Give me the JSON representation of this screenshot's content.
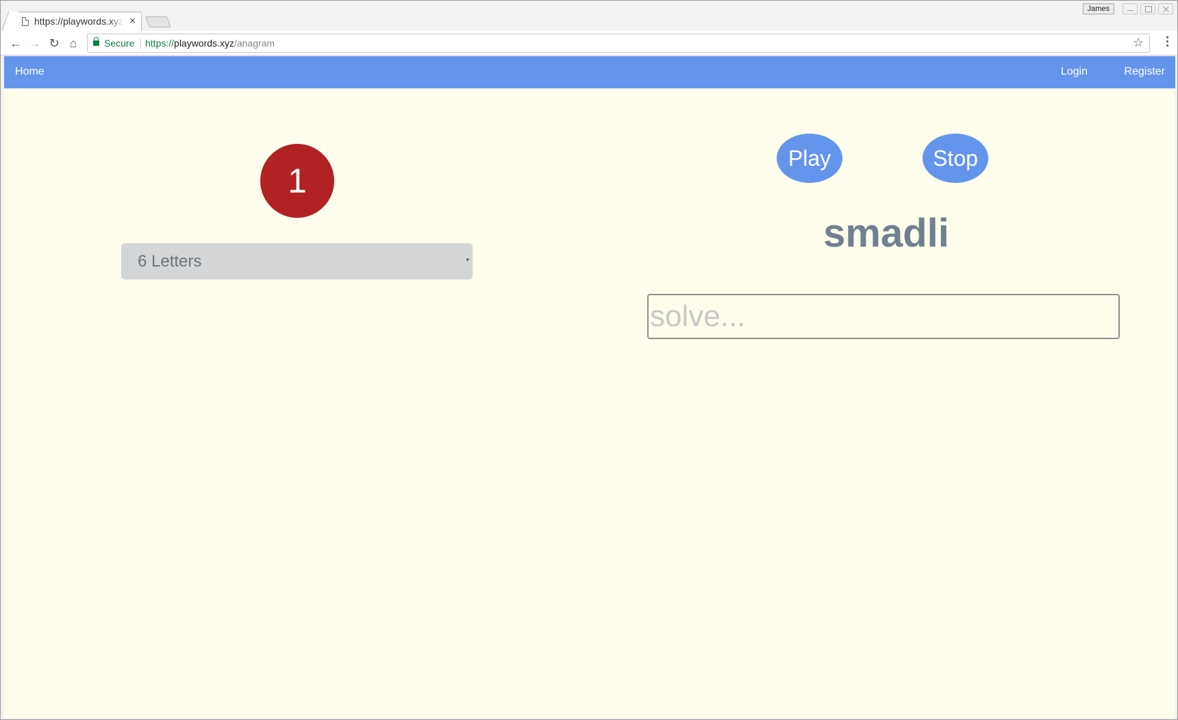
{
  "browser": {
    "tab_title": "https://playwords.xyz/anagram",
    "tab_close": "×",
    "profile_name": "James",
    "secure_label": "Secure",
    "url_scheme": "https://",
    "url_host": "playwords.xyz",
    "url_path": "/anagram",
    "icons": {
      "back": "←",
      "forward": "→",
      "reload": "↻",
      "home": "⌂",
      "star": "☆"
    }
  },
  "navbar": {
    "home": "Home",
    "login": "Login",
    "register": "Register"
  },
  "game": {
    "counter": "1",
    "letters_select": "6 Letters",
    "select_caret": "▾",
    "play": "Play",
    "stop": "Stop",
    "scrambled_word": "smadli",
    "solve_placeholder": "solve..."
  },
  "colors": {
    "navbar": "#6495ed",
    "page_background": "#fffeec",
    "counter": "#b22222",
    "buttons": "#6495ed",
    "scrambled_word": "#708090"
  }
}
